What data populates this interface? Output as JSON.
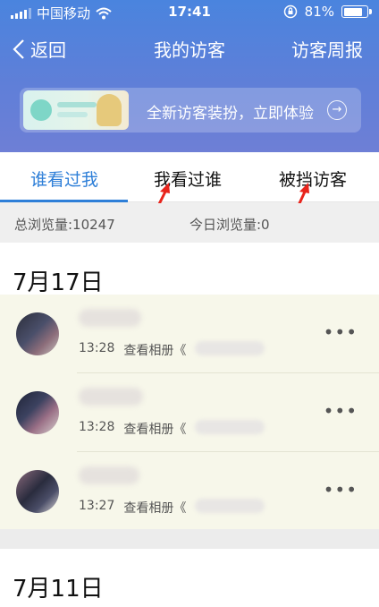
{
  "status_bar": {
    "carrier": "中国移动",
    "time": "17:41",
    "battery_text": "81%",
    "battery_level_percent": 81,
    "icons": [
      "signal-icon",
      "wifi-icon",
      "rotation-lock-icon",
      "battery-icon"
    ]
  },
  "nav": {
    "back_label": "返回",
    "title": "我的访客",
    "weekly_label": "访客周报"
  },
  "banner": {
    "text": "全新访客装扮，立即体验"
  },
  "tabs": [
    {
      "label": "谁看过我",
      "active": true
    },
    {
      "label": "我看过谁",
      "active": false
    },
    {
      "label": "被挡访客",
      "active": false
    }
  ],
  "stats": {
    "total": "总浏览量:10247",
    "today": "今日浏览量:0"
  },
  "dates": [
    "7月17日",
    "7月11日"
  ],
  "visitors": [
    {
      "time": "13:28",
      "action": "查看相册《"
    },
    {
      "time": "13:28",
      "action": "查看相册《"
    },
    {
      "time": "13:27",
      "action": "查看相册《"
    }
  ],
  "more_glyph": "•••",
  "colors": {
    "header_blue": "#4a84de",
    "tab_active": "#2e7fd8",
    "annotation_red": "#e8241c",
    "list_bg": "#f7f7ea"
  }
}
